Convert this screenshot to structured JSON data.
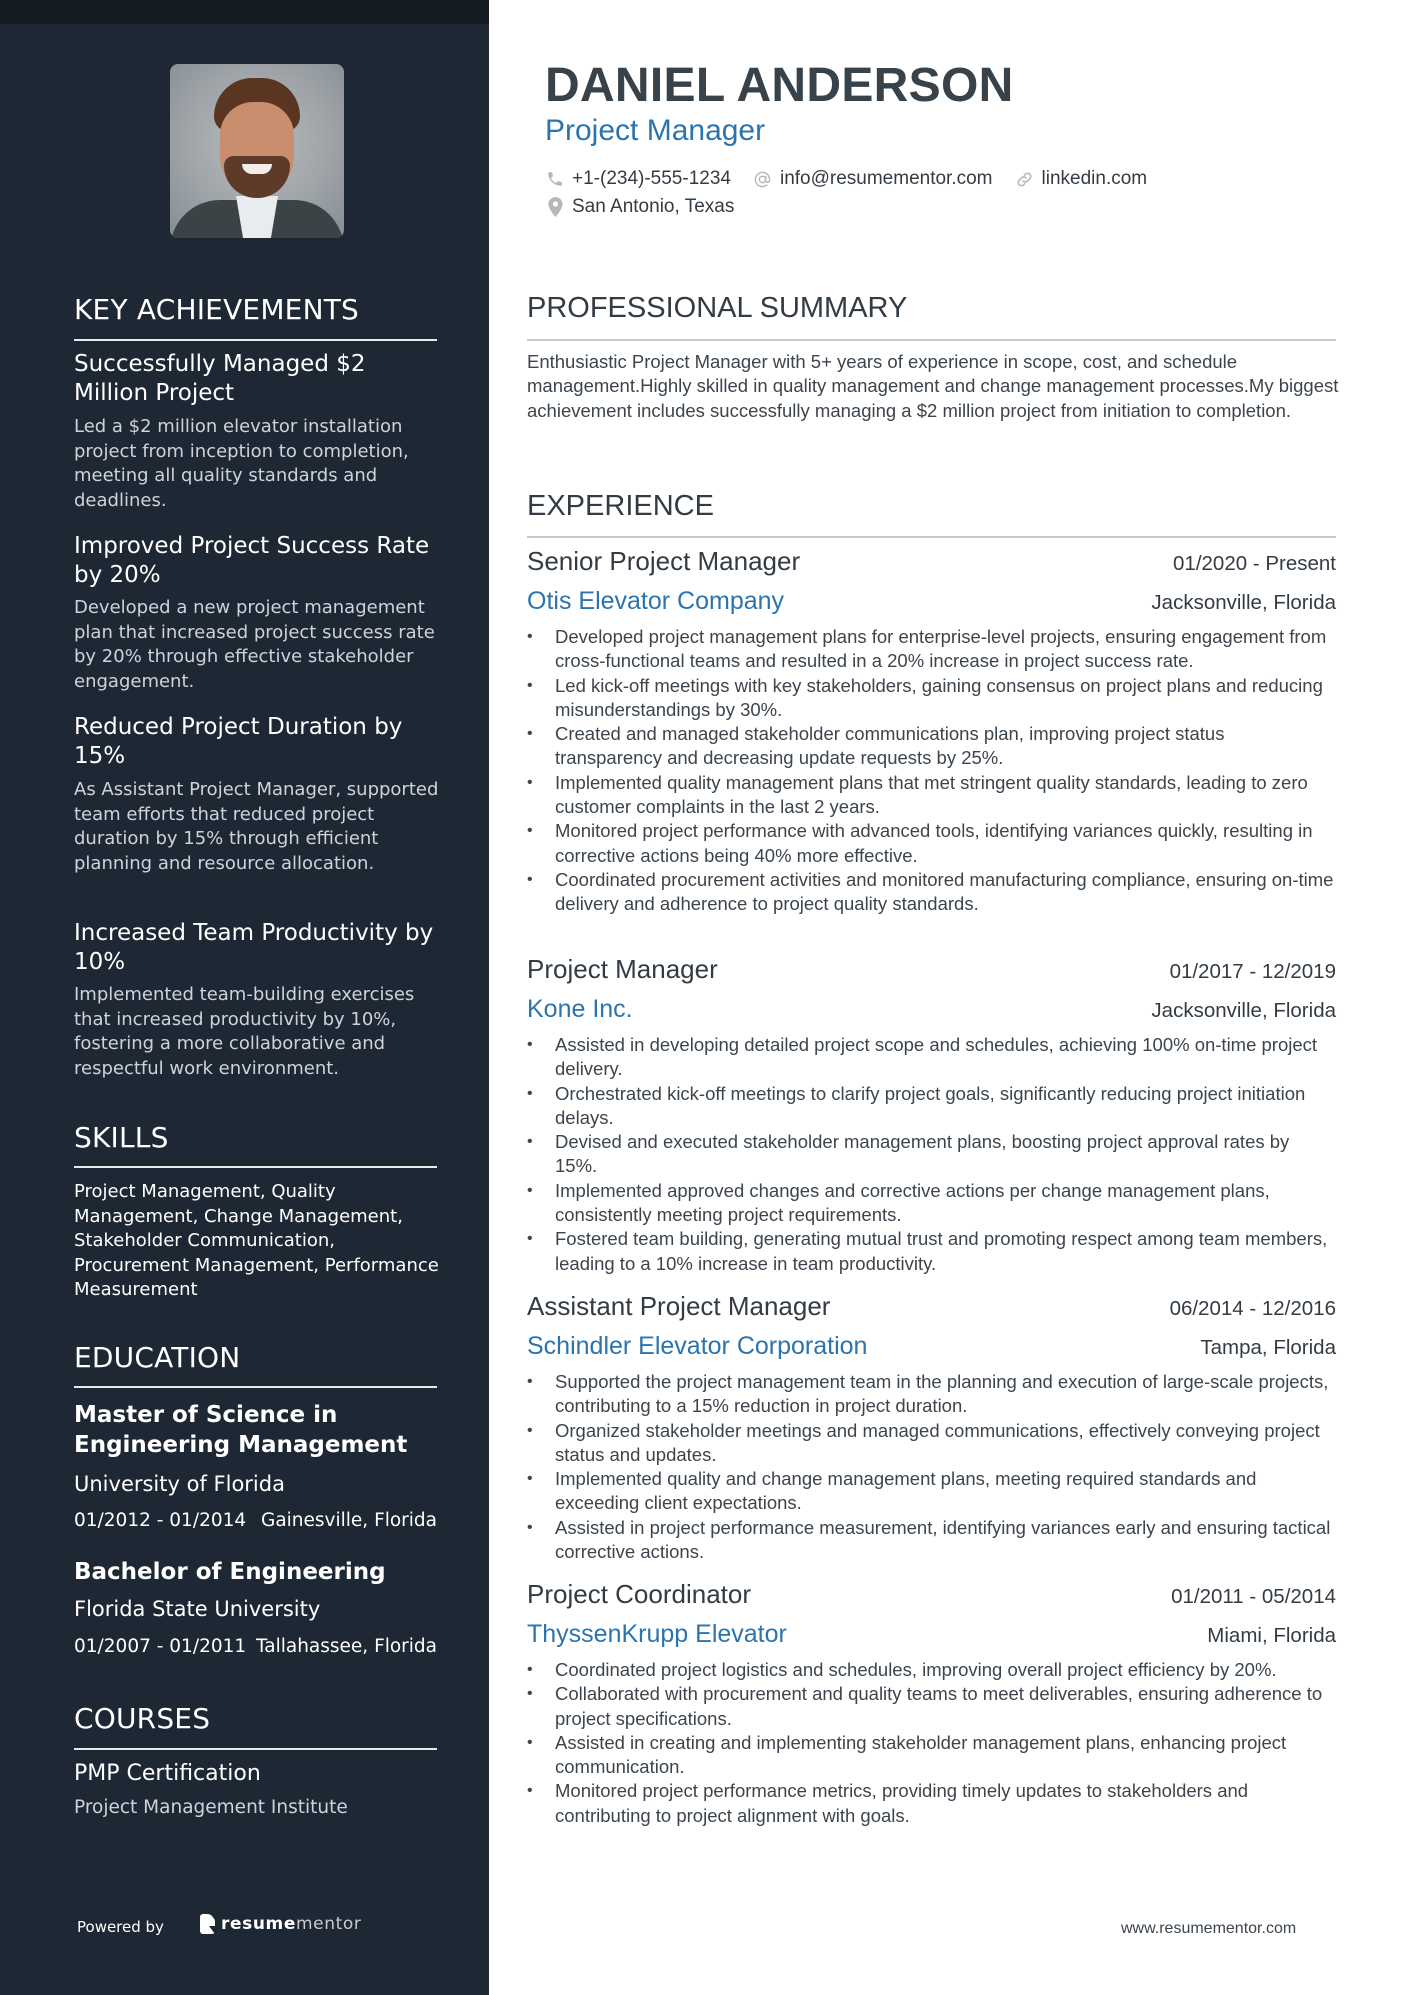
{
  "header": {
    "name": "DANIEL ANDERSON",
    "title": "Project Manager",
    "contacts": {
      "phone": "+1-(234)-555-1234",
      "email": "info@resumementor.com",
      "linkedin": "linkedin.com",
      "location": "San Antonio, Texas"
    }
  },
  "colors": {
    "sidebar": "#1e2834",
    "sidebar_top": "#151b23",
    "accent": "#2b74ad",
    "text": "#333c44"
  },
  "sidebar": {
    "achievements_title": "KEY ACHIEVEMENTS",
    "achievements": [
      {
        "title": "Successfully Managed $2 Million Project",
        "desc": "Led a $2 million elevator installation project from inception to completion, meeting all quality standards and deadlines."
      },
      {
        "title": "Improved Project Success Rate by 20%",
        "desc": "Developed a new project management plan that increased project success rate by 20% through effective stakeholder engagement."
      },
      {
        "title": "Reduced Project Duration by 15%",
        "desc": "As Assistant Project Manager, supported team efforts that reduced project duration by 15% through efficient planning and resource allocation."
      },
      {
        "title": "Increased Team Productivity by 10%",
        "desc": "Implemented team-building exercises that increased productivity by 10%, fostering a more collaborative and respectful work environment."
      }
    ],
    "skills_title": "SKILLS",
    "skills_text": "Project Management, Quality Management, Change Management, Stakeholder Communication, Procurement Management, Performance Measurement",
    "education_title": "EDUCATION",
    "education": [
      {
        "degree": "Master of Science in Engineering Management",
        "school": "University of Florida",
        "dates": "01/2012 - 01/2014",
        "location": "Gainesville, Florida"
      },
      {
        "degree": "Bachelor of Engineering",
        "school": "Florida State University",
        "dates": "01/2007 - 01/2011",
        "location": "Tallahassee, Florida"
      }
    ],
    "courses_title": "COURSES",
    "courses": [
      {
        "name": "PMP Certification",
        "org": "Project Management Institute"
      }
    ],
    "powered_by": "Powered by",
    "brand_bold": "resume",
    "brand_light": "mentor"
  },
  "main": {
    "summary_title": "PROFESSIONAL SUMMARY",
    "summary": "Enthusiastic Project Manager with 5+ years of experience in scope, cost, and schedule management.Highly skilled in quality management and change management processes.My biggest achievement includes successfully managing a $2 million project from initiation to completion.",
    "experience_title": "EXPERIENCE",
    "experience": [
      {
        "role": "Senior Project Manager",
        "dates": "01/2020 - Present",
        "company": "Otis Elevator Company",
        "location": "Jacksonville, Florida",
        "bullets": [
          "Developed project management plans for enterprise-level projects, ensuring engagement from cross-functional teams and resulted in a 20% increase in project success rate.",
          "Led kick-off meetings with key stakeholders, gaining consensus on project plans and reducing misunderstandings by 30%.",
          "Created and managed stakeholder communications plan, improving project status transparency and decreasing update requests by 25%.",
          "Implemented quality management plans that met stringent quality standards, leading to zero customer complaints in the last 2 years.",
          "Monitored project performance with advanced tools, identifying variances quickly, resulting in corrective actions being 40% more effective.",
          "Coordinated procurement activities and monitored manufacturing compliance, ensuring on-time delivery and adherence to project quality standards."
        ]
      },
      {
        "role": "Project Manager",
        "dates": "01/2017 - 12/2019",
        "company": "Kone Inc.",
        "location": "Jacksonville, Florida",
        "bullets": [
          "Assisted in developing detailed project scope and schedules, achieving 100% on-time project delivery.",
          "Orchestrated kick-off meetings to clarify project goals, significantly reducing project initiation delays.",
          "Devised and executed stakeholder management plans, boosting project approval rates by 15%.",
          "Implemented approved changes and corrective actions per change management plans, consistently meeting project requirements.",
          "Fostered team building, generating mutual trust and promoting respect among team members, leading to a 10% increase in team productivity."
        ]
      },
      {
        "role": "Assistant Project Manager",
        "dates": "06/2014 - 12/2016",
        "company": "Schindler Elevator Corporation",
        "location": "Tampa, Florida",
        "bullets": [
          "Supported the project management team in the planning and execution of large-scale projects, contributing to a 15% reduction in project duration.",
          "Organized stakeholder meetings and managed communications, effectively conveying project status and updates.",
          "Implemented quality and change management plans, meeting required standards and exceeding client expectations.",
          "Assisted in project performance measurement, identifying variances early and ensuring tactical corrective actions."
        ]
      },
      {
        "role": "Project Coordinator",
        "dates": "01/2011 - 05/2014",
        "company": "ThyssenKrupp Elevator",
        "location": "Miami, Florida",
        "bullets": [
          "Coordinated project logistics and schedules, improving overall project efficiency by 20%.",
          "Collaborated with procurement and quality teams to meet deliverables, ensuring adherence to project specifications.",
          "Assisted in creating and implementing stakeholder management plans, enhancing project communication.",
          "Monitored project performance metrics, providing timely updates to stakeholders and contributing to project alignment with goals."
        ]
      }
    ],
    "footer_url": "www.resumementor.com"
  }
}
